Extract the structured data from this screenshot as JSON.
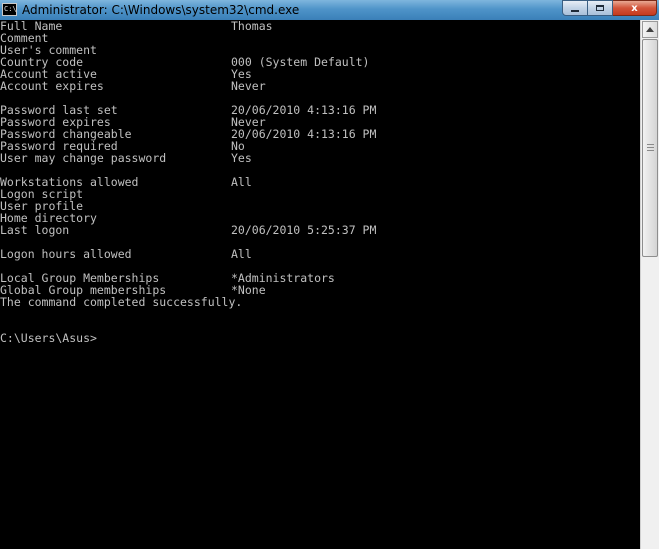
{
  "window": {
    "title": "Administrator: C:\\Windows\\system32\\cmd.exe",
    "icon_text": "C:\\",
    "close_label": "x"
  },
  "console": {
    "text_color": "#c0c0c0",
    "background": "#000000",
    "lines": [
      {
        "label": "Full Name",
        "value": "Thomas"
      },
      {
        "label": "Comment",
        "value": ""
      },
      {
        "label": "User's comment",
        "value": ""
      },
      {
        "label": "Country code",
        "value": "000 (System Default)"
      },
      {
        "label": "Account active",
        "value": "Yes"
      },
      {
        "label": "Account expires",
        "value": "Never"
      },
      {
        "label": "",
        "value": ""
      },
      {
        "label": "Password last set",
        "value": "20/06/2010 4:13:16 PM"
      },
      {
        "label": "Password expires",
        "value": "Never"
      },
      {
        "label": "Password changeable",
        "value": "20/06/2010 4:13:16 PM"
      },
      {
        "label": "Password required",
        "value": "No"
      },
      {
        "label": "User may change password",
        "value": "Yes"
      },
      {
        "label": "",
        "value": ""
      },
      {
        "label": "Workstations allowed",
        "value": "All"
      },
      {
        "label": "Logon script",
        "value": ""
      },
      {
        "label": "User profile",
        "value": ""
      },
      {
        "label": "Home directory",
        "value": ""
      },
      {
        "label": "Last logon",
        "value": "20/06/2010 5:25:37 PM"
      },
      {
        "label": "",
        "value": ""
      },
      {
        "label": "Logon hours allowed",
        "value": "All"
      },
      {
        "label": "",
        "value": ""
      },
      {
        "label": "Local Group Memberships",
        "value": "*Administrators"
      },
      {
        "label": "Global Group memberships",
        "value": "*None"
      }
    ],
    "completion_message": "The command completed successfully.",
    "prompt": "C:\\Users\\Asus>"
  }
}
